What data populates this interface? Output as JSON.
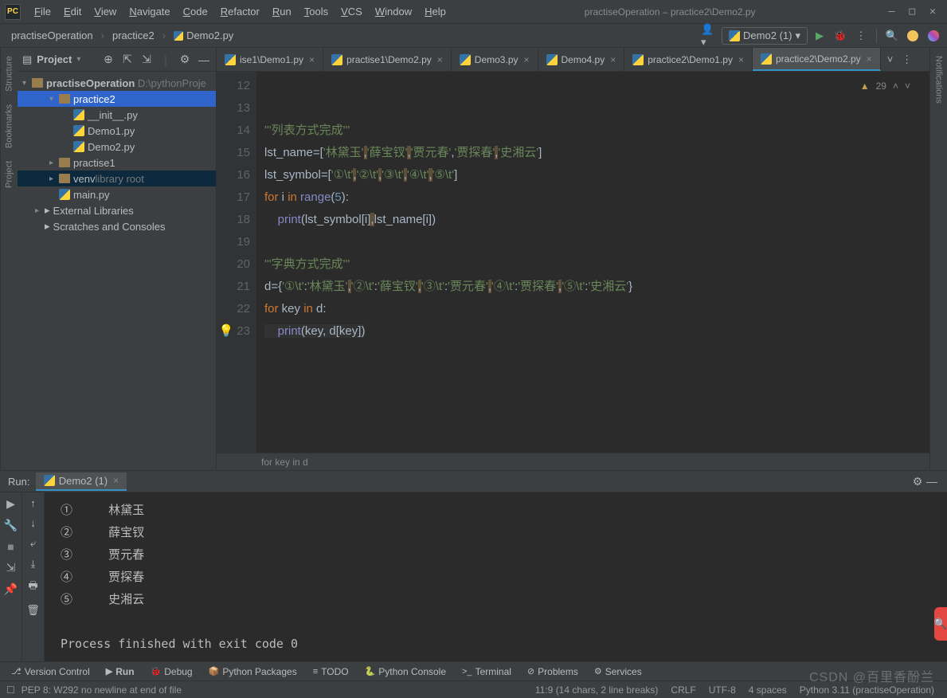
{
  "window": {
    "title": "practiseOperation – practice2\\Demo2.py",
    "min": "—",
    "max": "□",
    "close": "✕"
  },
  "menu": [
    "File",
    "Edit",
    "View",
    "Navigate",
    "Code",
    "Refactor",
    "Run",
    "Tools",
    "VCS",
    "Window",
    "Help"
  ],
  "breadcrumbs": [
    "practiseOperation",
    "practice2",
    "Demo2.py"
  ],
  "run_config": {
    "label": "Demo2 (1)",
    "dropdown": "▾"
  },
  "project": {
    "title": "Project",
    "root": {
      "name": "practiseOperation",
      "path": "D:\\pythonProje"
    },
    "items": [
      {
        "level": 1,
        "chev": "▾",
        "icon": "folder",
        "name": "practice2",
        "sel": true
      },
      {
        "level": 2,
        "icon": "py",
        "name": "__init__.py"
      },
      {
        "level": 2,
        "icon": "py",
        "name": "Demo1.py"
      },
      {
        "level": 2,
        "icon": "py",
        "name": "Demo2.py"
      },
      {
        "level": 1,
        "chev": "▸",
        "icon": "folder",
        "name": "practise1"
      },
      {
        "level": 1,
        "chev": "▸",
        "icon": "folder",
        "name": "venv",
        "note": "library root",
        "sel2": true
      },
      {
        "level": 1,
        "icon": "py",
        "name": "main.py"
      },
      {
        "level": 0,
        "chev": "▸",
        "icon": "lib",
        "name": "External Libraries"
      },
      {
        "level": 0,
        "icon": "scratch",
        "name": "Scratches and Consoles"
      }
    ]
  },
  "tabs": [
    {
      "label": "ise1\\Demo1.py"
    },
    {
      "label": "practise1\\Demo2.py"
    },
    {
      "label": "Demo3.py"
    },
    {
      "label": "Demo4.py"
    },
    {
      "label": "practice2\\Demo1.py"
    },
    {
      "label": "practice2\\Demo2.py",
      "active": true
    }
  ],
  "editor": {
    "warnings": "29",
    "lines": [
      12,
      13,
      14,
      15,
      16,
      17,
      18,
      19,
      20,
      21,
      22,
      23
    ],
    "bulb_line": 23,
    "code_html": "\n\n<span class='str'>'''列表方式完成'''\n</span>lst_name=[<span class='str'>'林黛玉'</span><span class='comma-hl'>,</span><span class='str'>'薛宝钗'</span><span class='comma-hl'>,</span><span class='str'>'贾元春'</span>,<span class='str'>'贾探春'</span><span class='comma-hl'>,</span><span class='str'>'史湘云'</span>]\nlst_symbol=[<span class='str'>'①\\t'</span><span class='comma-hl'>,</span><span class='str'>'②\\t'</span><span class='comma-hl'>,</span><span class='str'>'③\\t'</span><span class='comma-hl'>,</span><span class='str'>'④\\t'</span><span class='comma-hl'>,</span><span class='str'>'⑤\\t'</span>]\n<span class='kw'>for</span> i <span class='kw'>in</span> <span class='fn2'>range</span>(<span class='num'>5</span>):\n    <span class='fn2'>print</span>(lst_symbol[i]<span class='comma-hl'>,</span>lst_name[i])\n\n<span class='str'>'''字典方式完成'''\n</span>d={<span class='str'>'①\\t'</span>:<span class='str'>'林黛玉'</span><span class='comma-hl'>,</span><span class='str'>'②\\t'</span>:<span class='str'>'薛宝钗'</span><span class='comma-hl'>,</span><span class='str'>'③\\t'</span>:<span class='str'>'贾元春'</span><span class='comma-hl'>,</span><span class='str'>'④\\t'</span>:<span class='str'>'贾探春'</span><span class='comma-hl'>,</span><span class='str'>'⑤\\t'</span>:<span class='str'>'史湘云'</span>}\n<span class='kw'>for</span> key <span class='kw'>in</span> d:\n<span class='caret-line'>    <span class='fn2'>print</span>(key, d[key])</span>",
    "breadcrumb": "for key in d"
  },
  "run": {
    "label": "Run:",
    "tab": "Demo2 (1)",
    "output": "①     林黛玉\n②     薛宝钗\n③     贾元春\n④     贾探春\n⑤     史湘云\n\nProcess finished with exit code 0"
  },
  "bottom": [
    {
      "icon": "⎇",
      "label": "Version Control"
    },
    {
      "icon": "▶",
      "label": "Run",
      "active": true
    },
    {
      "icon": "🐞",
      "label": "Debug"
    },
    {
      "icon": "📦",
      "label": "Python Packages"
    },
    {
      "icon": "≡",
      "label": "TODO"
    },
    {
      "icon": "🐍",
      "label": "Python Console"
    },
    {
      "icon": ">_",
      "label": "Terminal"
    },
    {
      "icon": "⊘",
      "label": "Problems"
    },
    {
      "icon": "⚙",
      "label": "Services"
    }
  ],
  "status": {
    "msg": "PEP 8: W292 no newline at end of file",
    "pos": "11:9 (14 chars, 2 line breaks)",
    "sep": "CRLF",
    "enc": "UTF-8",
    "indent": "4 spaces",
    "interp": "Python 3.11 (practiseOperation)"
  },
  "left_rail": [
    "Project",
    "Bookmarks",
    "Structure"
  ],
  "right_rail": "Notifications",
  "watermark": "CSDN @百里香酚兰"
}
